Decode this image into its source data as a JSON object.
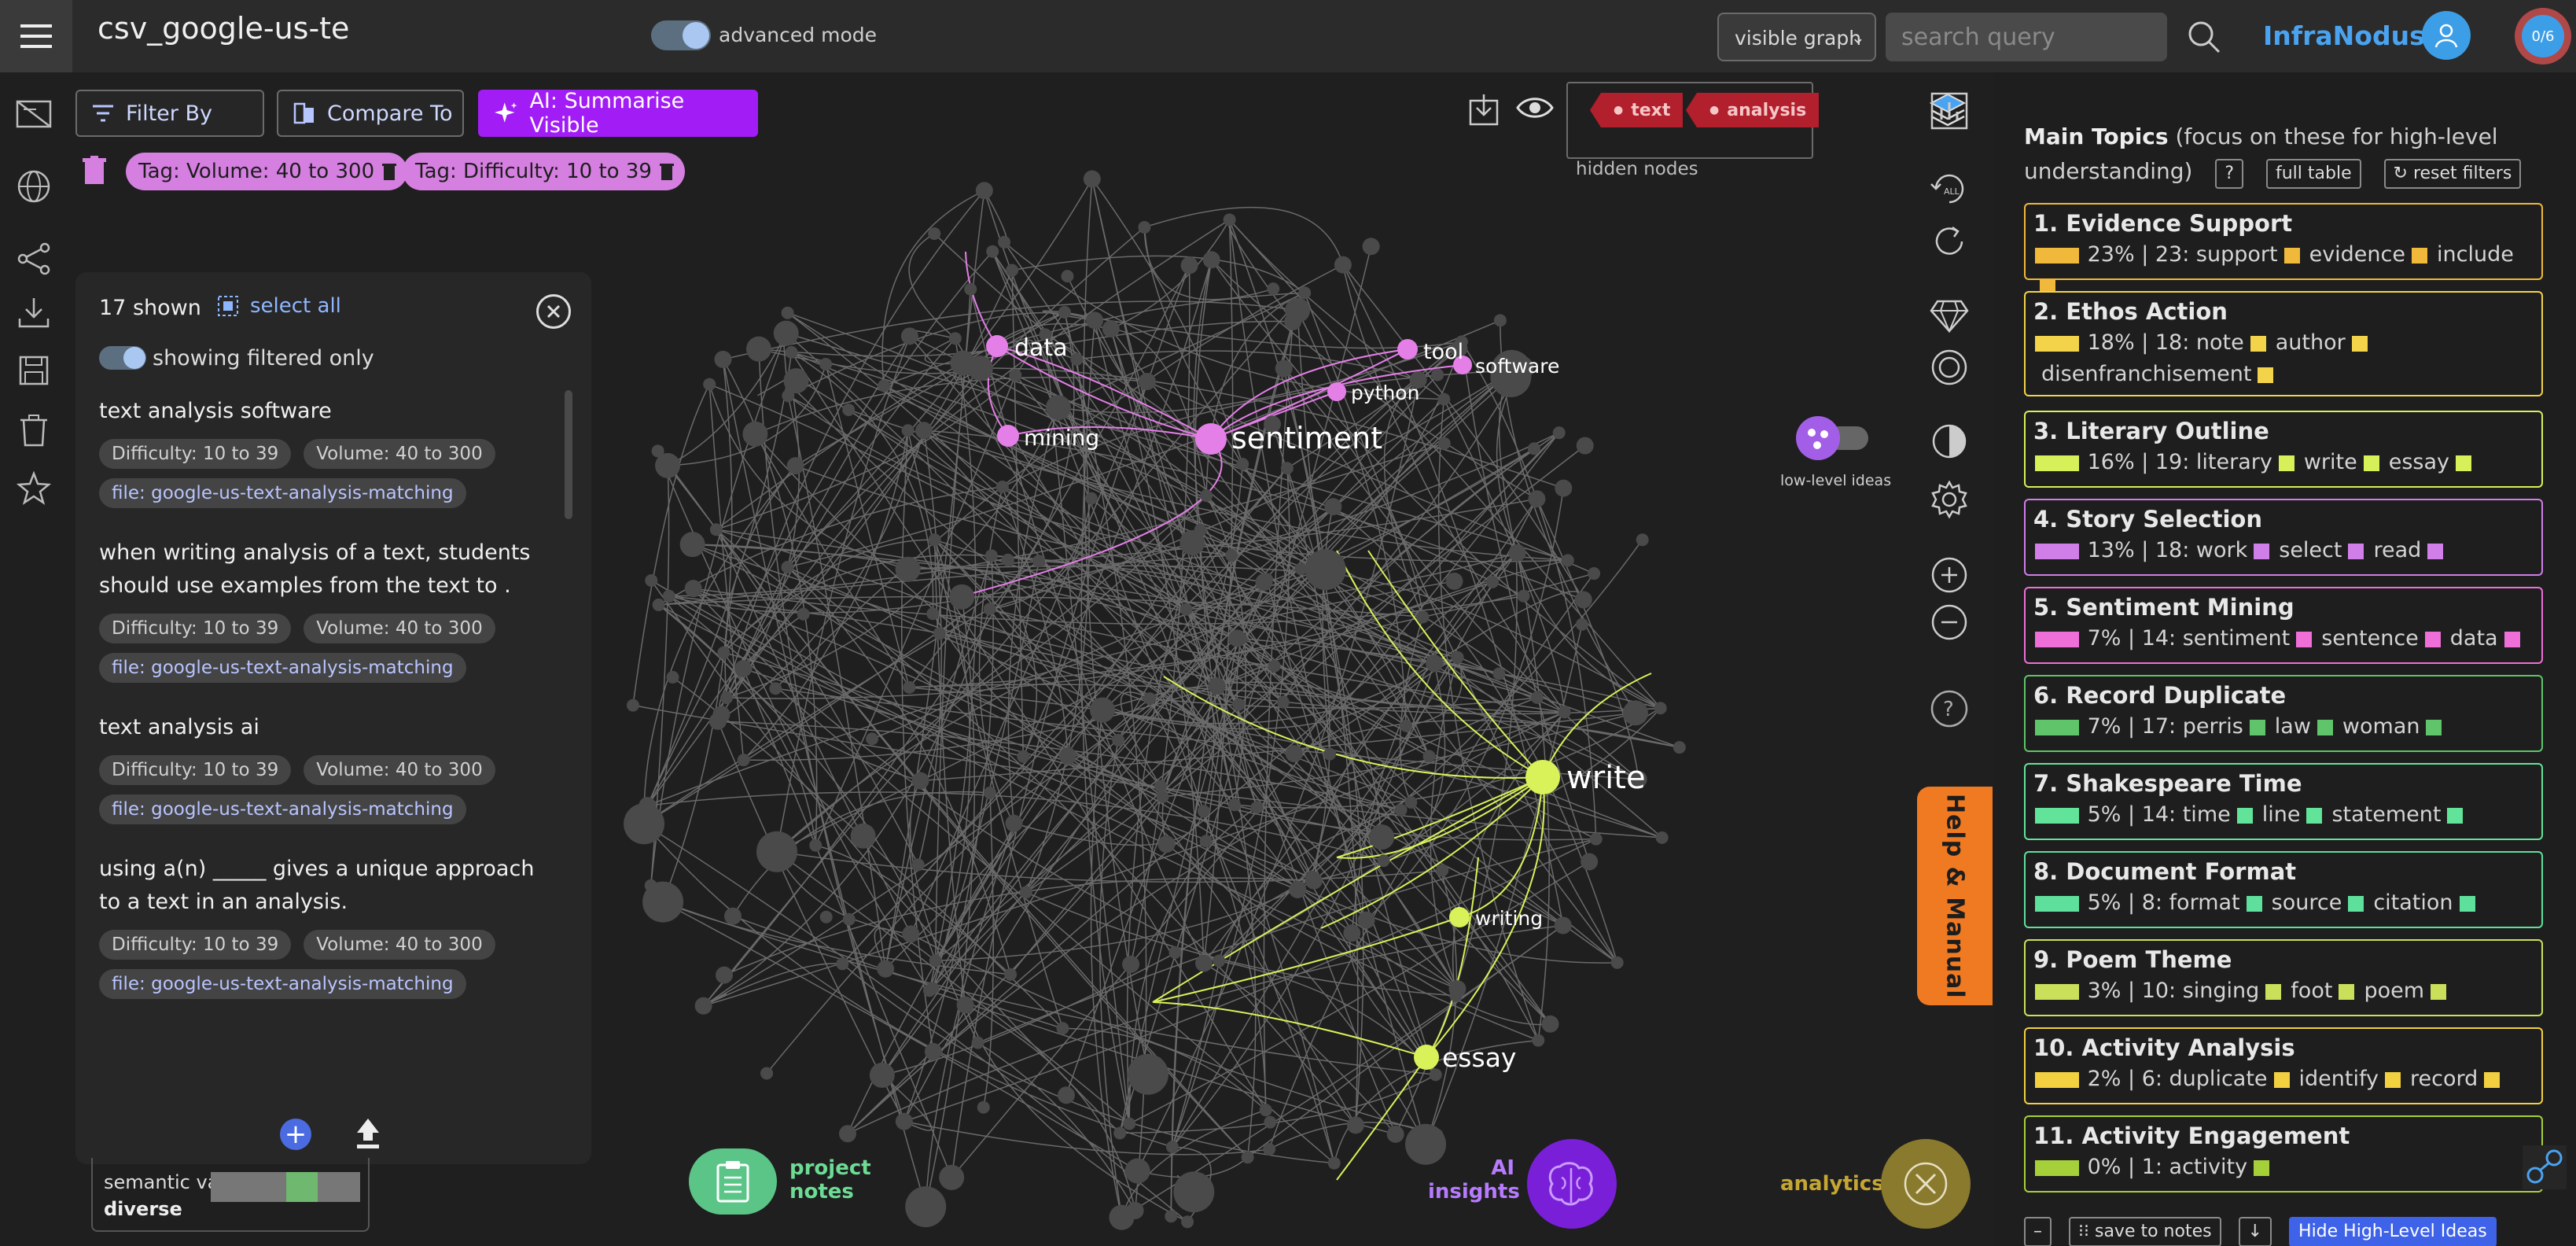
{
  "header": {
    "title": "csv_google-us-te",
    "advanced_mode_label": "advanced mode",
    "view_select": "visible graph",
    "search_placeholder": "search query",
    "brand": "InfraNodus",
    "counter": "0/6"
  },
  "toolbar": {
    "filter_by": "Filter By",
    "compare_to": "Compare To",
    "ai_summarise": "AI: Summarise Visible",
    "tags": [
      "Tag: Volume: 40 to 300",
      "Tag: Difficulty: 10 to 39"
    ],
    "hidden_nodes": [
      "text",
      "analysis"
    ],
    "hidden_nodes_label": "hidden nodes"
  },
  "results": {
    "count": "17 shown",
    "select_all": "select all",
    "filtered_label": "showing filtered only",
    "items": [
      {
        "text": "text analysis software",
        "tags": [
          "Difficulty: 10 to 39",
          "Volume: 40 to 300"
        ],
        "file": "file: google-us-text-analysis-matching"
      },
      {
        "text": "when writing analysis of a text, students should use examples from the text to .",
        "tags": [
          "Difficulty: 10 to 39",
          "Volume: 40 to 300"
        ],
        "file": "file: google-us-text-analysis-matching"
      },
      {
        "text": "text analysis ai",
        "tags": [
          "Difficulty: 10 to 39",
          "Volume: 40 to 300"
        ],
        "file": "file: google-us-text-analysis-matching"
      },
      {
        "text": "using a(n) _____ gives a unique approach to a text in an analysis.",
        "tags": [
          "Difficulty: 10 to 39",
          "Volume: 40 to 300"
        ],
        "file": "file: google-us-text-analysis-matching"
      }
    ]
  },
  "variability": {
    "label": "semantic variability:",
    "value": "diverse"
  },
  "graph": {
    "labels": {
      "data": "data",
      "mining": "mining",
      "sentiment": "sentiment",
      "python": "python",
      "tool": "tool",
      "software": "software",
      "write": "write",
      "writing": "writing",
      "essay": "essay"
    },
    "colors": {
      "pink": "#e57fe8",
      "lime": "#d9f25a",
      "node": "#4a4a4a",
      "edge": "#6a6a6a"
    },
    "low_level_label": "low-level ideas"
  },
  "bottom": {
    "project_notes": "project\nnotes",
    "ai_insights": "AI\ninsights",
    "analytics": "analytics"
  },
  "help_tab": "Help & Manual",
  "topics": {
    "heading": "Main Topics",
    "subheading": "(focus on these for high-level understanding)",
    "help_btn": "?",
    "full_table": "full table",
    "reset_filters": "↻ reset filters",
    "items": [
      {
        "title": "1. Evidence Support",
        "detail": "23% | 23: support",
        "words": [
          "evidence",
          "include"
        ],
        "color": "#f0b93c"
      },
      {
        "title": "2. Ethos Action",
        "detail": "18% | 18: note",
        "words": [
          "author",
          "disenfranchisement"
        ],
        "color": "#f2d34a"
      },
      {
        "title": "3. Literary Outline",
        "detail": "16% | 19: literary",
        "words": [
          "write",
          "essay"
        ],
        "color": "#d6f05a"
      },
      {
        "title": "4. Story Selection",
        "detail": "13% | 18: work",
        "words": [
          "select",
          "read"
        ],
        "color": "#d07ee8"
      },
      {
        "title": "5. Sentiment Mining",
        "detail": "7% | 14: sentiment",
        "words": [
          "sentence",
          "data"
        ],
        "color": "#ee6fd7"
      },
      {
        "title": "6. Record Duplicate",
        "detail": "7% | 17: perris",
        "words": [
          "law",
          "woman"
        ],
        "color": "#5fc46a"
      },
      {
        "title": "7. Shakespeare Time",
        "detail": "5% | 14: time",
        "words": [
          "line",
          "statement"
        ],
        "color": "#62e39a"
      },
      {
        "title": "8. Document Format",
        "detail": "5% | 8: format",
        "words": [
          "source",
          "citation"
        ],
        "color": "#5ee09c"
      },
      {
        "title": "9. Poem Theme",
        "detail": "3% | 10: singing",
        "words": [
          "foot",
          "poem"
        ],
        "color": "#cbe05a"
      },
      {
        "title": "10. Activity Analysis",
        "detail": "2% | 6: duplicate",
        "words": [
          "identify",
          "record"
        ],
        "color": "#f2d040"
      },
      {
        "title": "11. Activity Engagement",
        "detail": "0% | 1: activity",
        "words": [],
        "color": "#a6d03a"
      }
    ],
    "footer": {
      "minus": "–",
      "save_notes": "save to notes",
      "down": "↓",
      "hide": "Hide High-Level Ideas"
    }
  }
}
